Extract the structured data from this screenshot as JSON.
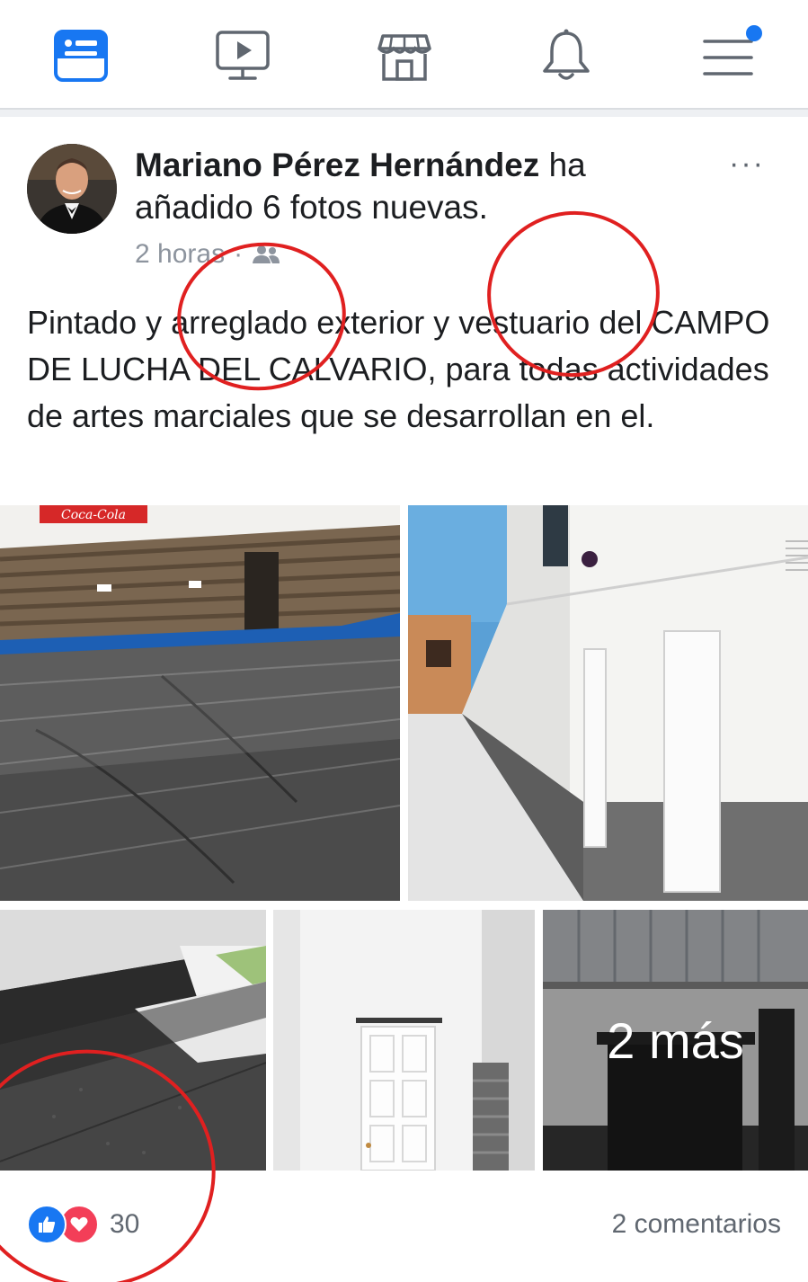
{
  "nav": {
    "items": [
      {
        "name": "news-feed-icon",
        "active": true
      },
      {
        "name": "watch-icon",
        "active": false
      },
      {
        "name": "marketplace-icon",
        "active": false
      },
      {
        "name": "notifications-bell-icon",
        "active": false
      },
      {
        "name": "menu-icon",
        "active": false,
        "badge": true
      }
    ],
    "active_color": "#1877f2",
    "inactive_color": "#606770"
  },
  "post": {
    "author": "Mariano Pérez Hernández",
    "action": " ha añadido 6 fotos nuevas.",
    "time": "2 horas",
    "separator": "·",
    "audience_icon": "friends-icon",
    "more_label": "···",
    "text": "Pintado y arreglado exterior y vestuario del CAMPO DE LUCHA DEL CALVARIO, para todas actividades de artes marciales que se desarrollan en el.",
    "photos": {
      "p1_sign": "Coca-Cola",
      "more_overlay": "2 más"
    }
  },
  "footer": {
    "reactions": [
      "like-icon",
      "love-icon"
    ],
    "reaction_count": "30",
    "comments": "2 comentarios"
  },
  "colors": {
    "accent": "#1877f2",
    "love": "#f33e58",
    "annotation": "#e02020",
    "meta_text": "#8d949e"
  }
}
